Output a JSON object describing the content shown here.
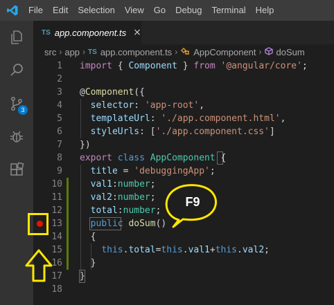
{
  "menubar": {
    "items": [
      "File",
      "Edit",
      "Selection",
      "View",
      "Go",
      "Debug",
      "Terminal",
      "Help"
    ]
  },
  "activity_bar": {
    "items": [
      "explorer-icon",
      "search-icon",
      "source-control-icon",
      "debug-icon",
      "extensions-icon"
    ],
    "source_control_badge": "3"
  },
  "tab": {
    "icon_text": "TS",
    "label": "app.component.ts",
    "close": "×"
  },
  "breadcrumbs": {
    "items": [
      "src",
      "app",
      "app.component.ts",
      "AppComponent",
      "doSum"
    ],
    "ts_icon": "TS"
  },
  "editor": {
    "lines": [
      {
        "n": "1",
        "tokens": [
          [
            "kw",
            "import"
          ],
          [
            "pun",
            " { "
          ],
          [
            "prop",
            "Component"
          ],
          [
            "pun",
            " } "
          ],
          [
            "kw",
            "from"
          ],
          [
            "pun",
            " "
          ],
          [
            "str",
            "'@angular/core'"
          ],
          [
            "pun",
            ";"
          ]
        ]
      },
      {
        "n": "2",
        "tokens": []
      },
      {
        "n": "3",
        "tokens": [
          [
            "pun",
            "@"
          ],
          [
            "fn",
            "Component"
          ],
          [
            "pun",
            "({"
          ]
        ]
      },
      {
        "n": "4",
        "tokens": [
          [
            "pun",
            "  "
          ],
          [
            "prop",
            "selector"
          ],
          [
            "pun",
            ": "
          ],
          [
            "str",
            "'app-root'"
          ],
          [
            "pun",
            ","
          ]
        ]
      },
      {
        "n": "5",
        "tokens": [
          [
            "pun",
            "  "
          ],
          [
            "prop",
            "templateUrl"
          ],
          [
            "pun",
            ": "
          ],
          [
            "str",
            "'./app.component.html'"
          ],
          [
            "pun",
            ","
          ]
        ]
      },
      {
        "n": "6",
        "tokens": [
          [
            "pun",
            "  "
          ],
          [
            "prop",
            "styleUrls"
          ],
          [
            "pun",
            ": ["
          ],
          [
            "str",
            "'./app.component.css'"
          ],
          [
            "pun",
            "]"
          ]
        ]
      },
      {
        "n": "7",
        "tokens": [
          [
            "pun",
            "})"
          ]
        ]
      },
      {
        "n": "8",
        "tokens": [
          [
            "kw",
            "export"
          ],
          [
            "pun",
            " "
          ],
          [
            "kw2",
            "class"
          ],
          [
            "pun",
            " "
          ],
          [
            "cls",
            "AppComponent"
          ],
          [
            "pun",
            " {"
          ]
        ]
      },
      {
        "n": "9",
        "tokens": [
          [
            "pun",
            "  "
          ],
          [
            "prop",
            "title"
          ],
          [
            "pun",
            " = "
          ],
          [
            "str",
            "'debuggingApp'"
          ],
          [
            "pun",
            ";"
          ]
        ]
      },
      {
        "n": "10",
        "tokens": [
          [
            "pun",
            "  "
          ],
          [
            "prop",
            "val1"
          ],
          [
            "pun",
            ":"
          ],
          [
            "typ",
            "number"
          ],
          [
            "pun",
            ";"
          ]
        ]
      },
      {
        "n": "11",
        "tokens": [
          [
            "pun",
            "  "
          ],
          [
            "prop",
            "val2"
          ],
          [
            "pun",
            ":"
          ],
          [
            "typ",
            "number"
          ],
          [
            "pun",
            ";"
          ]
        ]
      },
      {
        "n": "12",
        "tokens": [
          [
            "pun",
            "  "
          ],
          [
            "prop",
            "total"
          ],
          [
            "pun",
            ":"
          ],
          [
            "typ",
            "number"
          ],
          [
            "pun",
            ";"
          ]
        ]
      },
      {
        "n": "13",
        "tokens": [
          [
            "pun",
            "  "
          ],
          [
            "kw2",
            "public"
          ],
          [
            "pun",
            " "
          ],
          [
            "fn",
            "doSum"
          ],
          [
            "pun",
            "()"
          ]
        ]
      },
      {
        "n": "14",
        "tokens": [
          [
            "pun",
            "  {"
          ]
        ]
      },
      {
        "n": "15",
        "tokens": [
          [
            "pun",
            "    "
          ],
          [
            "kw2",
            "this"
          ],
          [
            "pun",
            "."
          ],
          [
            "prop",
            "total"
          ],
          [
            "pun",
            "="
          ],
          [
            "kw2",
            "this"
          ],
          [
            "pun",
            "."
          ],
          [
            "prop",
            "val1"
          ],
          [
            "pun",
            "+"
          ],
          [
            "kw2",
            "this"
          ],
          [
            "pun",
            "."
          ],
          [
            "prop",
            "val2"
          ],
          [
            "pun",
            ";"
          ]
        ]
      },
      {
        "n": "16",
        "tokens": [
          [
            "pun",
            "  }"
          ]
        ]
      },
      {
        "n": "17",
        "tokens": [
          [
            "pun",
            "}"
          ]
        ]
      },
      {
        "n": "18",
        "tokens": []
      }
    ]
  },
  "annotation": {
    "callout_text": "F9"
  },
  "colors": {
    "highlight": "#ffe600",
    "breakpoint": "#e51400",
    "accent": "#007acc"
  }
}
